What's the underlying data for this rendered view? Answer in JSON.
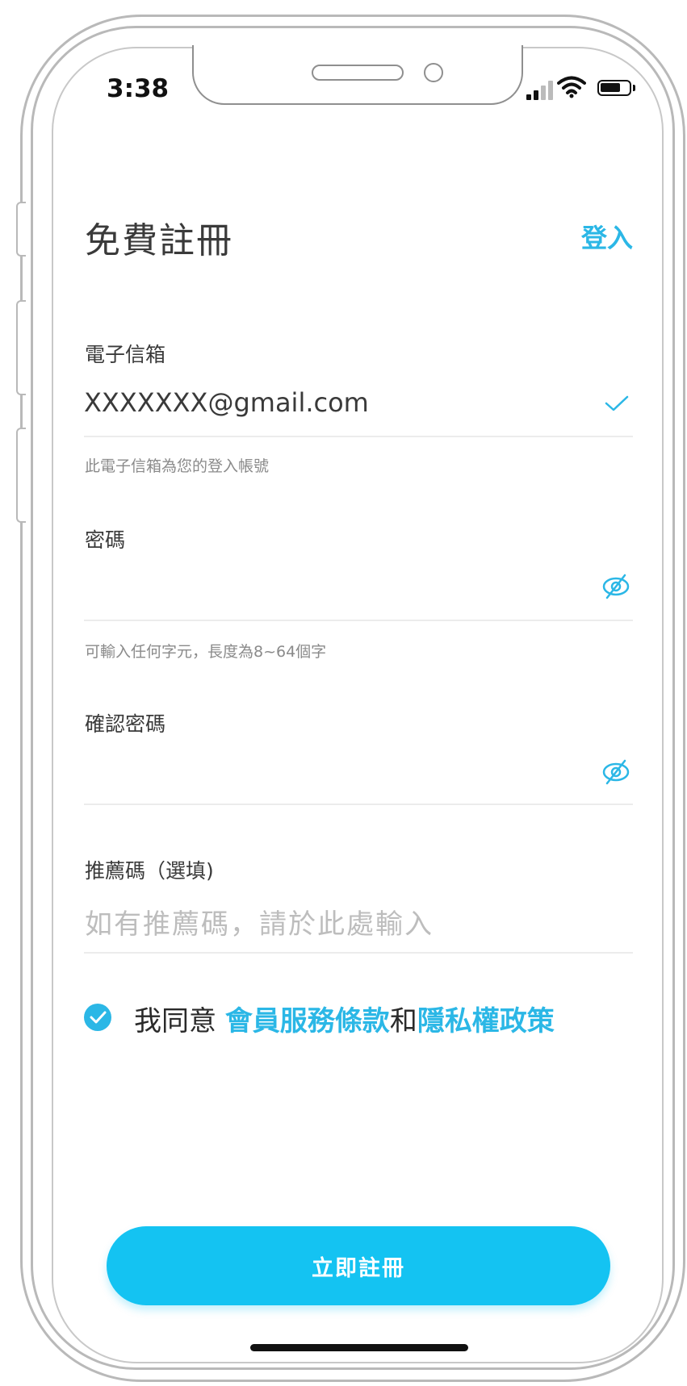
{
  "status_bar": {
    "time": "3:38"
  },
  "header": {
    "title": "免費註冊",
    "login_label": "登入"
  },
  "form": {
    "email": {
      "label": "電子信箱",
      "value": "XXXXXXX@gmail.com",
      "valid": true,
      "helper": "此電子信箱為您的登入帳號"
    },
    "password": {
      "label": "密碼",
      "value": "",
      "helper": "可輸入任何字元，長度為8~64個字"
    },
    "confirm_password": {
      "label": "確認密碼",
      "value": ""
    },
    "referral": {
      "label": "推薦碼（選填)",
      "placeholder": "如有推薦碼，請於此處輸入",
      "value": ""
    },
    "agree": {
      "checked": true,
      "prefix": "我同意",
      "terms_link": "會員服務條款",
      "conjunction": "和",
      "privacy_link": "隱私權政策"
    },
    "submit_label": "立即註冊"
  },
  "colors": {
    "accent": "#2bb7e6",
    "button": "#14c3f2",
    "text": "#3a3a3a",
    "helper_text": "#8a8a8a",
    "placeholder": "#bdbdbd",
    "divider": "#ececec"
  },
  "icons": {
    "email_status": "check-icon",
    "password_toggle": "eye-off-icon",
    "confirm_toggle": "eye-off-icon",
    "agree_checkbox": "checked-circle-icon"
  }
}
